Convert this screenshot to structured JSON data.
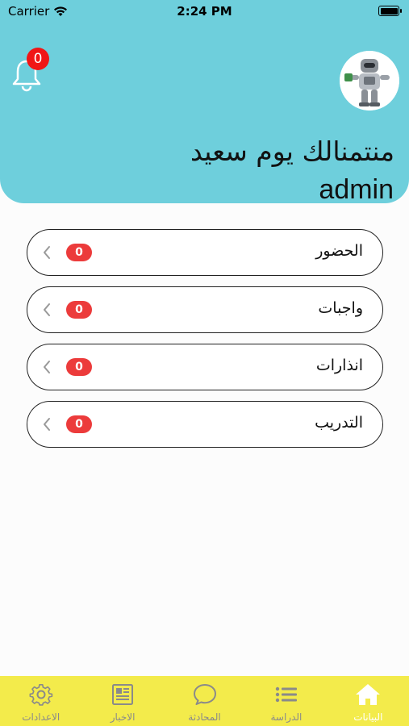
{
  "status_bar": {
    "carrier": "Carrier",
    "time": "2:24 PM"
  },
  "header": {
    "notification_count": "0",
    "greeting": "منتمنالك يوم سعيد",
    "username": "admin"
  },
  "menu": {
    "items": [
      {
        "label": "الحضور",
        "count": "0"
      },
      {
        "label": "واجبات",
        "count": "0"
      },
      {
        "label": "انذارات",
        "count": "0"
      },
      {
        "label": "التدريب",
        "count": "0"
      }
    ]
  },
  "tabbar": {
    "tabs": [
      {
        "label": "الاعدادات",
        "icon": "gear-icon"
      },
      {
        "label": "الاخبار",
        "icon": "newspaper-icon"
      },
      {
        "label": "المحادثة",
        "icon": "chat-bubble-icon"
      },
      {
        "label": "الدراسة",
        "icon": "list-icon"
      },
      {
        "label": "البيانات",
        "icon": "home-icon",
        "active": true
      }
    ]
  },
  "colors": {
    "header": "#6ecfdc",
    "tabbar": "#f3eb4b",
    "badge": "#ec3b3b"
  }
}
